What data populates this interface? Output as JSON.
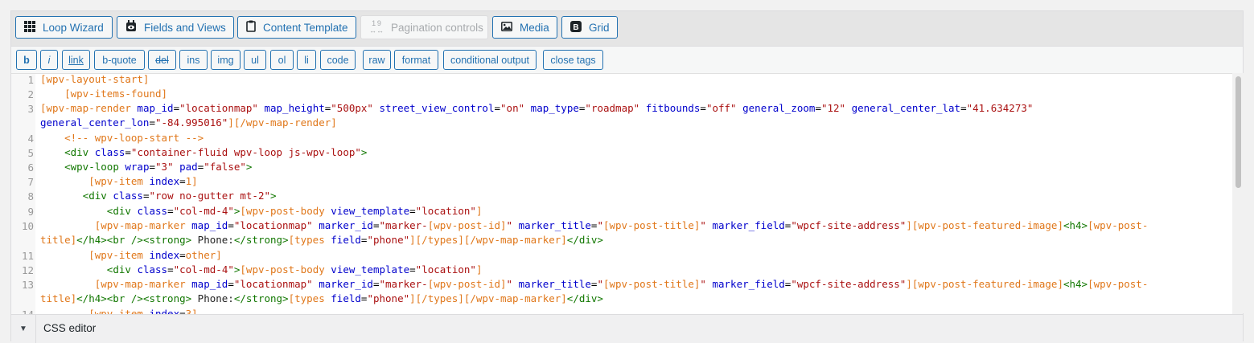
{
  "toolbar": {
    "buttons": [
      {
        "label": "Loop Wizard",
        "icon": "grid-dots-icon"
      },
      {
        "label": "Fields and Views",
        "icon": "eye-stamp-icon"
      },
      {
        "label": "Content Template",
        "icon": "clipboard-icon"
      },
      {
        "label": "Pagination controls",
        "icon": "pagination-icon",
        "disabled": true
      },
      {
        "label": "Media",
        "icon": "image-icon"
      },
      {
        "label": "Grid",
        "icon": "bootstrap-icon"
      }
    ]
  },
  "quicktags": [
    "b",
    "i",
    "link",
    "b-quote",
    "del",
    "ins",
    "img",
    "ul",
    "ol",
    "li",
    "code",
    "raw",
    "format",
    "conditional output",
    "close tags"
  ],
  "editor": {
    "line_numbers": [
      "1",
      "2",
      "3",
      "",
      "4",
      "5",
      "6",
      "7",
      "8",
      "9",
      "10",
      "",
      "11",
      "12",
      "13",
      "",
      "14"
    ]
  },
  "footer": {
    "label": "CSS editor"
  },
  "colors": {
    "accent": "#2271b1",
    "shortcode": "#e0771a",
    "tag": "#117700",
    "attr": "#0000cc",
    "string": "#aa1111"
  }
}
